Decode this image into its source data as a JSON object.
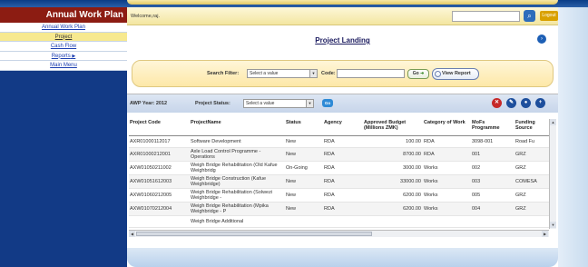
{
  "sidebar": {
    "title": "Annual Work Plan",
    "items": [
      {
        "label": "Annual Work Plan",
        "active": false
      },
      {
        "label": "Project",
        "active": true
      },
      {
        "label": "Cash Flow",
        "active": false
      },
      {
        "label": "Reports",
        "active": false,
        "has_submenu": true
      },
      {
        "label": "Main Menu",
        "active": false
      }
    ]
  },
  "header": {
    "welcome": "Welcome,raj.",
    "logout_label": "Logout"
  },
  "page_title": "Project Landing",
  "filter": {
    "search_filter_label": "Search Filter:",
    "search_filter_value": "Select a value",
    "code_label": "Code:",
    "go_label": "Go",
    "view_report_label": "View Report"
  },
  "grid_toolbar": {
    "awp_year_label": "AWP Year: 2012",
    "project_status_label": "Project Status:",
    "project_status_value": "Select a value",
    "go_label": "Go"
  },
  "table": {
    "columns": [
      "Project Code",
      "ProjectName",
      "Status",
      "Agency",
      "Approved Budget (Millions ZMK)",
      "Category of Work",
      "MoFs Programme",
      "Funding Source"
    ],
    "rows": [
      [
        "AXR01000112017",
        "Software Development",
        "New",
        "RDA",
        "100.00",
        "RDA",
        "3098-001",
        "Road Fu"
      ],
      [
        "AXR01000212001",
        "Axle Load Control Programme - Operations",
        "New",
        "RDA",
        "8700.00",
        "RDA",
        "001",
        "GRZ"
      ],
      [
        "AXW01050211002",
        "Weigh Bridge Rehabilitation (Old Kafue Weighbridg",
        "On-Going",
        "RDA",
        "3000.00",
        "Works",
        "002",
        "GRZ"
      ],
      [
        "AXW01051612003",
        "Weigh Bridge Construction (Kafue Weighbridge)",
        "New",
        "RDA",
        "33000.00",
        "Works",
        "003",
        "COMESA"
      ],
      [
        "AXW01060212005",
        "Weigh Bridge Rehabilitation (Solwezi Weighbridge -",
        "New",
        "RDA",
        "6200.00",
        "Works",
        "005",
        "GRZ"
      ],
      [
        "AXW01070212004",
        "Weigh Bridge Rehabilitation (Mpika Weighbridge - P",
        "New",
        "RDA",
        "6200.00",
        "Works",
        "004",
        "GRZ"
      ],
      [
        "",
        "Weigh Bridge Additional",
        "",
        "",
        "",
        "",
        "",
        ""
      ]
    ]
  },
  "icons": {
    "search": "search-icon",
    "help": "help-icon",
    "delete": "delete-icon",
    "edit": "edit-icon",
    "refresh": "refresh-icon",
    "add": "add-icon"
  },
  "colors": {
    "sidebar_bg": "#123a86",
    "sidebar_header": "#8c1c12",
    "active_item": "#f7e98f",
    "header_bar": "#f3e6a1"
  }
}
